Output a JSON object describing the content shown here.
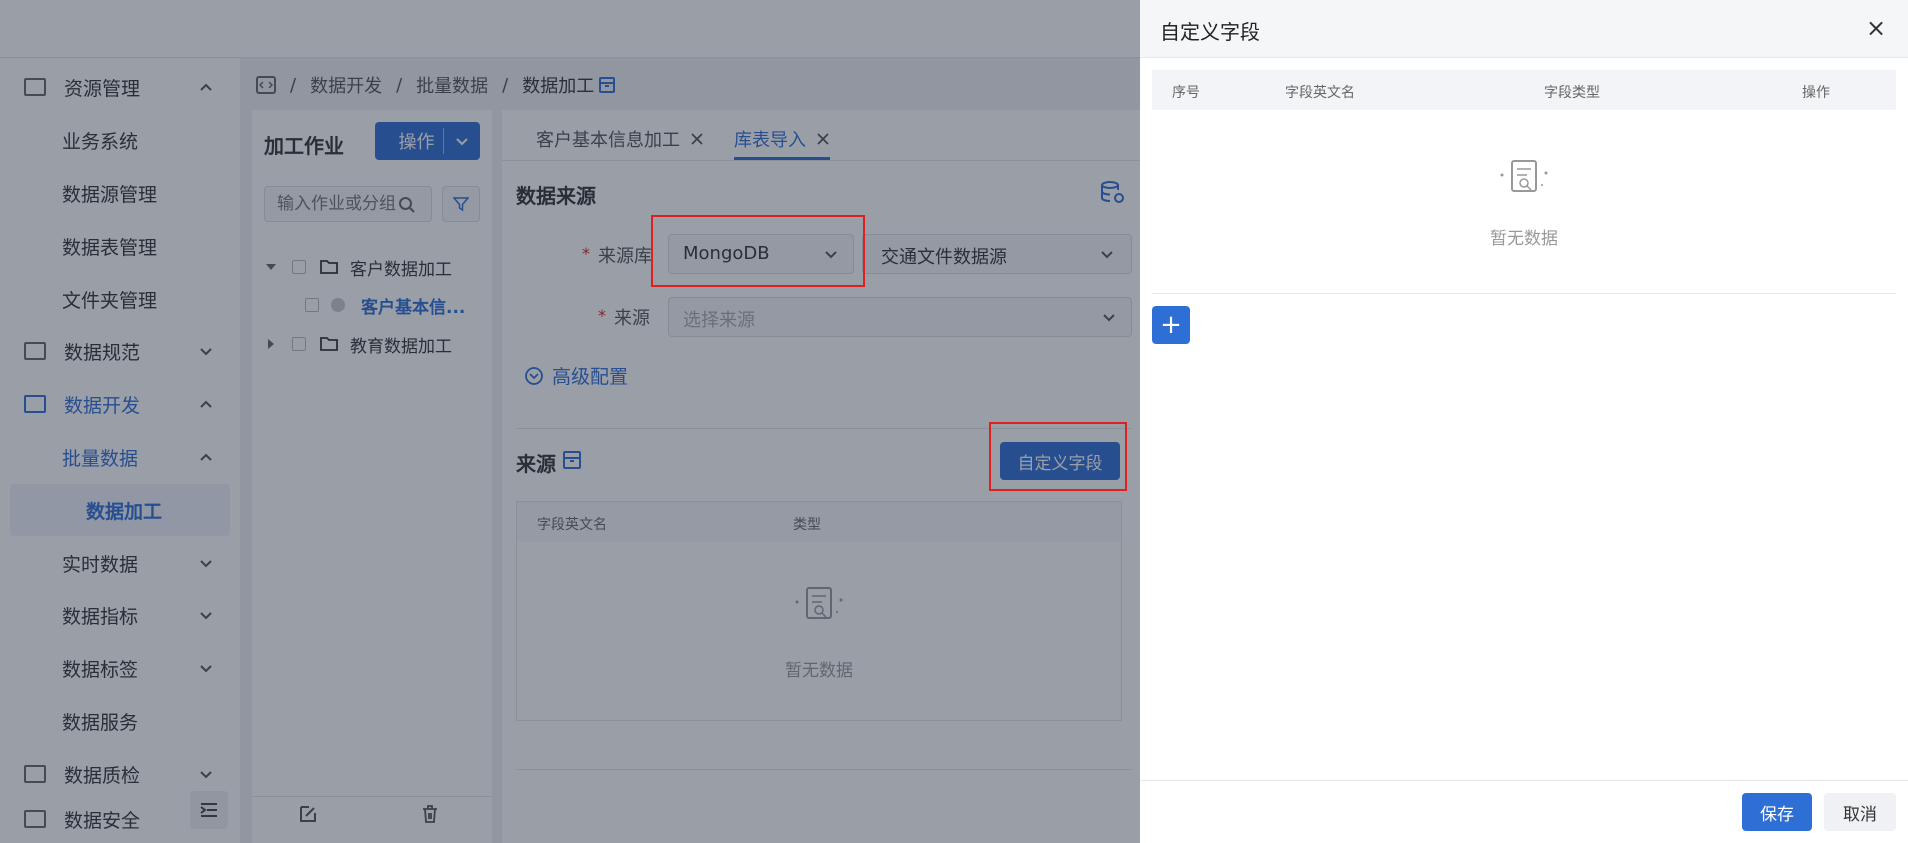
{
  "sidebar": {
    "items": [
      {
        "label": "资源管理",
        "icon": "monitor-icon",
        "chev": "up"
      },
      {
        "label": "业务系统"
      },
      {
        "label": "数据源管理"
      },
      {
        "label": "数据表管理"
      },
      {
        "label": "文件夹管理"
      },
      {
        "label": "数据规范",
        "icon": "monitor-icon",
        "chev": "down"
      },
      {
        "label": "数据开发",
        "icon": "code-icon",
        "chev": "up"
      },
      {
        "label": "批量数据",
        "chev": "up"
      },
      {
        "label": "数据加工"
      },
      {
        "label": "实时数据",
        "chev": "down"
      },
      {
        "label": "数据指标",
        "chev": "down"
      },
      {
        "label": "数据标签",
        "chev": "down"
      },
      {
        "label": "数据服务"
      },
      {
        "label": "数据质检",
        "icon": "monitor-icon",
        "chev": "down"
      },
      {
        "label": "数据安全",
        "icon": "check-icon"
      }
    ]
  },
  "breadcrumb": {
    "items": [
      "数据开发",
      "批量数据",
      "数据加工"
    ],
    "separator": "/"
  },
  "left_panel": {
    "title": "加工作业",
    "action_button": "操作",
    "search_placeholder": "输入作业或分组",
    "tree": [
      {
        "label": "客户数据加工",
        "expanded": true
      },
      {
        "label": "客户基本信..."
      },
      {
        "label": "教育数据加工",
        "expanded": false
      }
    ]
  },
  "tabs": [
    {
      "label": "客户基本信息加工"
    },
    {
      "label": "库表导入",
      "active": true
    }
  ],
  "form": {
    "section_title": "数据来源",
    "source_db_label": "来源库",
    "source_db_value": "MongoDB",
    "source_db2_value": "交通文件数据源",
    "source_label": "来源",
    "source_placeholder": "选择来源",
    "advanced": "高级配置",
    "required_mark": "*"
  },
  "source_section": {
    "title": "来源",
    "custom_fields_button": "自定义字段",
    "columns": [
      "字段英文名",
      "类型"
    ],
    "empty_text": "暂无数据"
  },
  "drawer": {
    "title": "自定义字段",
    "columns": [
      "序号",
      "字段英文名",
      "字段类型",
      "操作"
    ],
    "empty_text": "暂无数据",
    "add_button": "+",
    "save_button": "保存",
    "cancel_button": "取消",
    "close": "×"
  },
  "colors": {
    "primary": "#2e6fd6",
    "highlight": "#e02020"
  }
}
